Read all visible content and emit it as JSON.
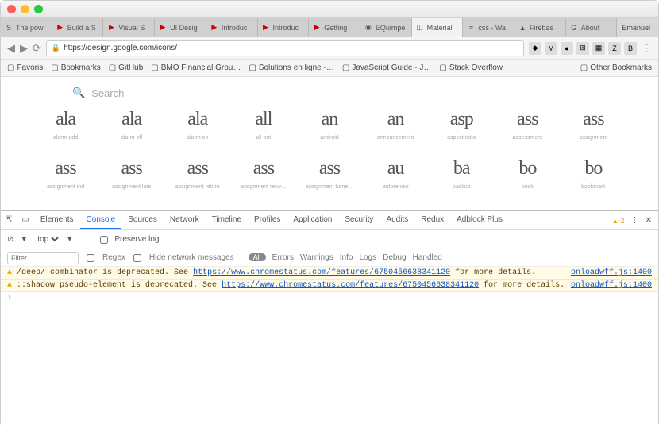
{
  "window": {
    "user": "Emanuel"
  },
  "tabs": [
    {
      "label": "The pow",
      "icon": "s"
    },
    {
      "label": "Build a S",
      "icon": "yt"
    },
    {
      "label": "Visual S",
      "icon": "yt"
    },
    {
      "label": "UI Desig",
      "icon": "yt"
    },
    {
      "label": "Introduc",
      "icon": "yt"
    },
    {
      "label": "Introduc",
      "icon": "yt"
    },
    {
      "label": "Getting",
      "icon": "yt"
    },
    {
      "label": "EQuimpe",
      "icon": "gh"
    },
    {
      "label": "Material",
      "icon": "md",
      "active": true
    },
    {
      "label": "css - Wa",
      "icon": "so"
    },
    {
      "label": "Firebas",
      "icon": "fb"
    },
    {
      "label": "About",
      "icon": "g"
    }
  ],
  "address": {
    "url": "https://design.google.com/icons/"
  },
  "bookmarks_bar": {
    "items": [
      "Favoris",
      "Bookmarks",
      "GitHub",
      "BMO Financial Grou…",
      "Solutions en ligne -…",
      "JavaScript Guide - J…",
      "Stack Overflow"
    ],
    "right": "Other Bookmarks"
  },
  "page": {
    "search_placeholder": "Search",
    "icons_row1": [
      {
        "glyph": "ala",
        "label": "alarm add"
      },
      {
        "glyph": "ala",
        "label": "alarm off"
      },
      {
        "glyph": "ala",
        "label": "alarm on"
      },
      {
        "glyph": "all",
        "label": "all out"
      },
      {
        "glyph": "an",
        "label": "android"
      },
      {
        "glyph": "an",
        "label": "announcement"
      },
      {
        "glyph": "asp",
        "label": "aspect ratio"
      },
      {
        "glyph": "ass",
        "label": "assessment"
      },
      {
        "glyph": "ass",
        "label": "assignment"
      }
    ],
    "icons_row2": [
      {
        "glyph": "ass",
        "label": "assignment ind"
      },
      {
        "glyph": "ass",
        "label": "assignment late"
      },
      {
        "glyph": "ass",
        "label": "assignment return"
      },
      {
        "glyph": "ass",
        "label": "assignment retur…"
      },
      {
        "glyph": "ass",
        "label": "assignment turne…"
      },
      {
        "glyph": "au",
        "label": "autorenew"
      },
      {
        "glyph": "ba",
        "label": "backup"
      },
      {
        "glyph": "bo",
        "label": "book"
      },
      {
        "glyph": "bo",
        "label": "bookmark"
      }
    ]
  },
  "devtools": {
    "tabs": [
      "Elements",
      "Console",
      "Sources",
      "Network",
      "Timeline",
      "Profiles",
      "Application",
      "Security",
      "Audits",
      "Redux",
      "Adblock Plus"
    ],
    "active_tab": "Console",
    "warn_count": "2",
    "filter_row": {
      "top": "top",
      "preserve": "Preserve log"
    },
    "sub_row": {
      "filter_placeholder": "Filter",
      "regex": "Regex",
      "hide": "Hide network messages",
      "levels": [
        "All",
        "Errors",
        "Warnings",
        "Info",
        "Logs",
        "Debug",
        "Handled"
      ]
    },
    "messages": [
      {
        "text": "/deep/ combinator is deprecated. See ",
        "link": "https://www.chromestatus.com/features/6750456638341120",
        "tail": " for more details.",
        "src": "onloadwff.js:1400"
      },
      {
        "text": "::shadow pseudo-element is deprecated. See ",
        "link": "https://www.chromestatus.com/features/6750456638341120",
        "tail": " for more details.",
        "src": "onloadwff.js:1400"
      }
    ]
  }
}
